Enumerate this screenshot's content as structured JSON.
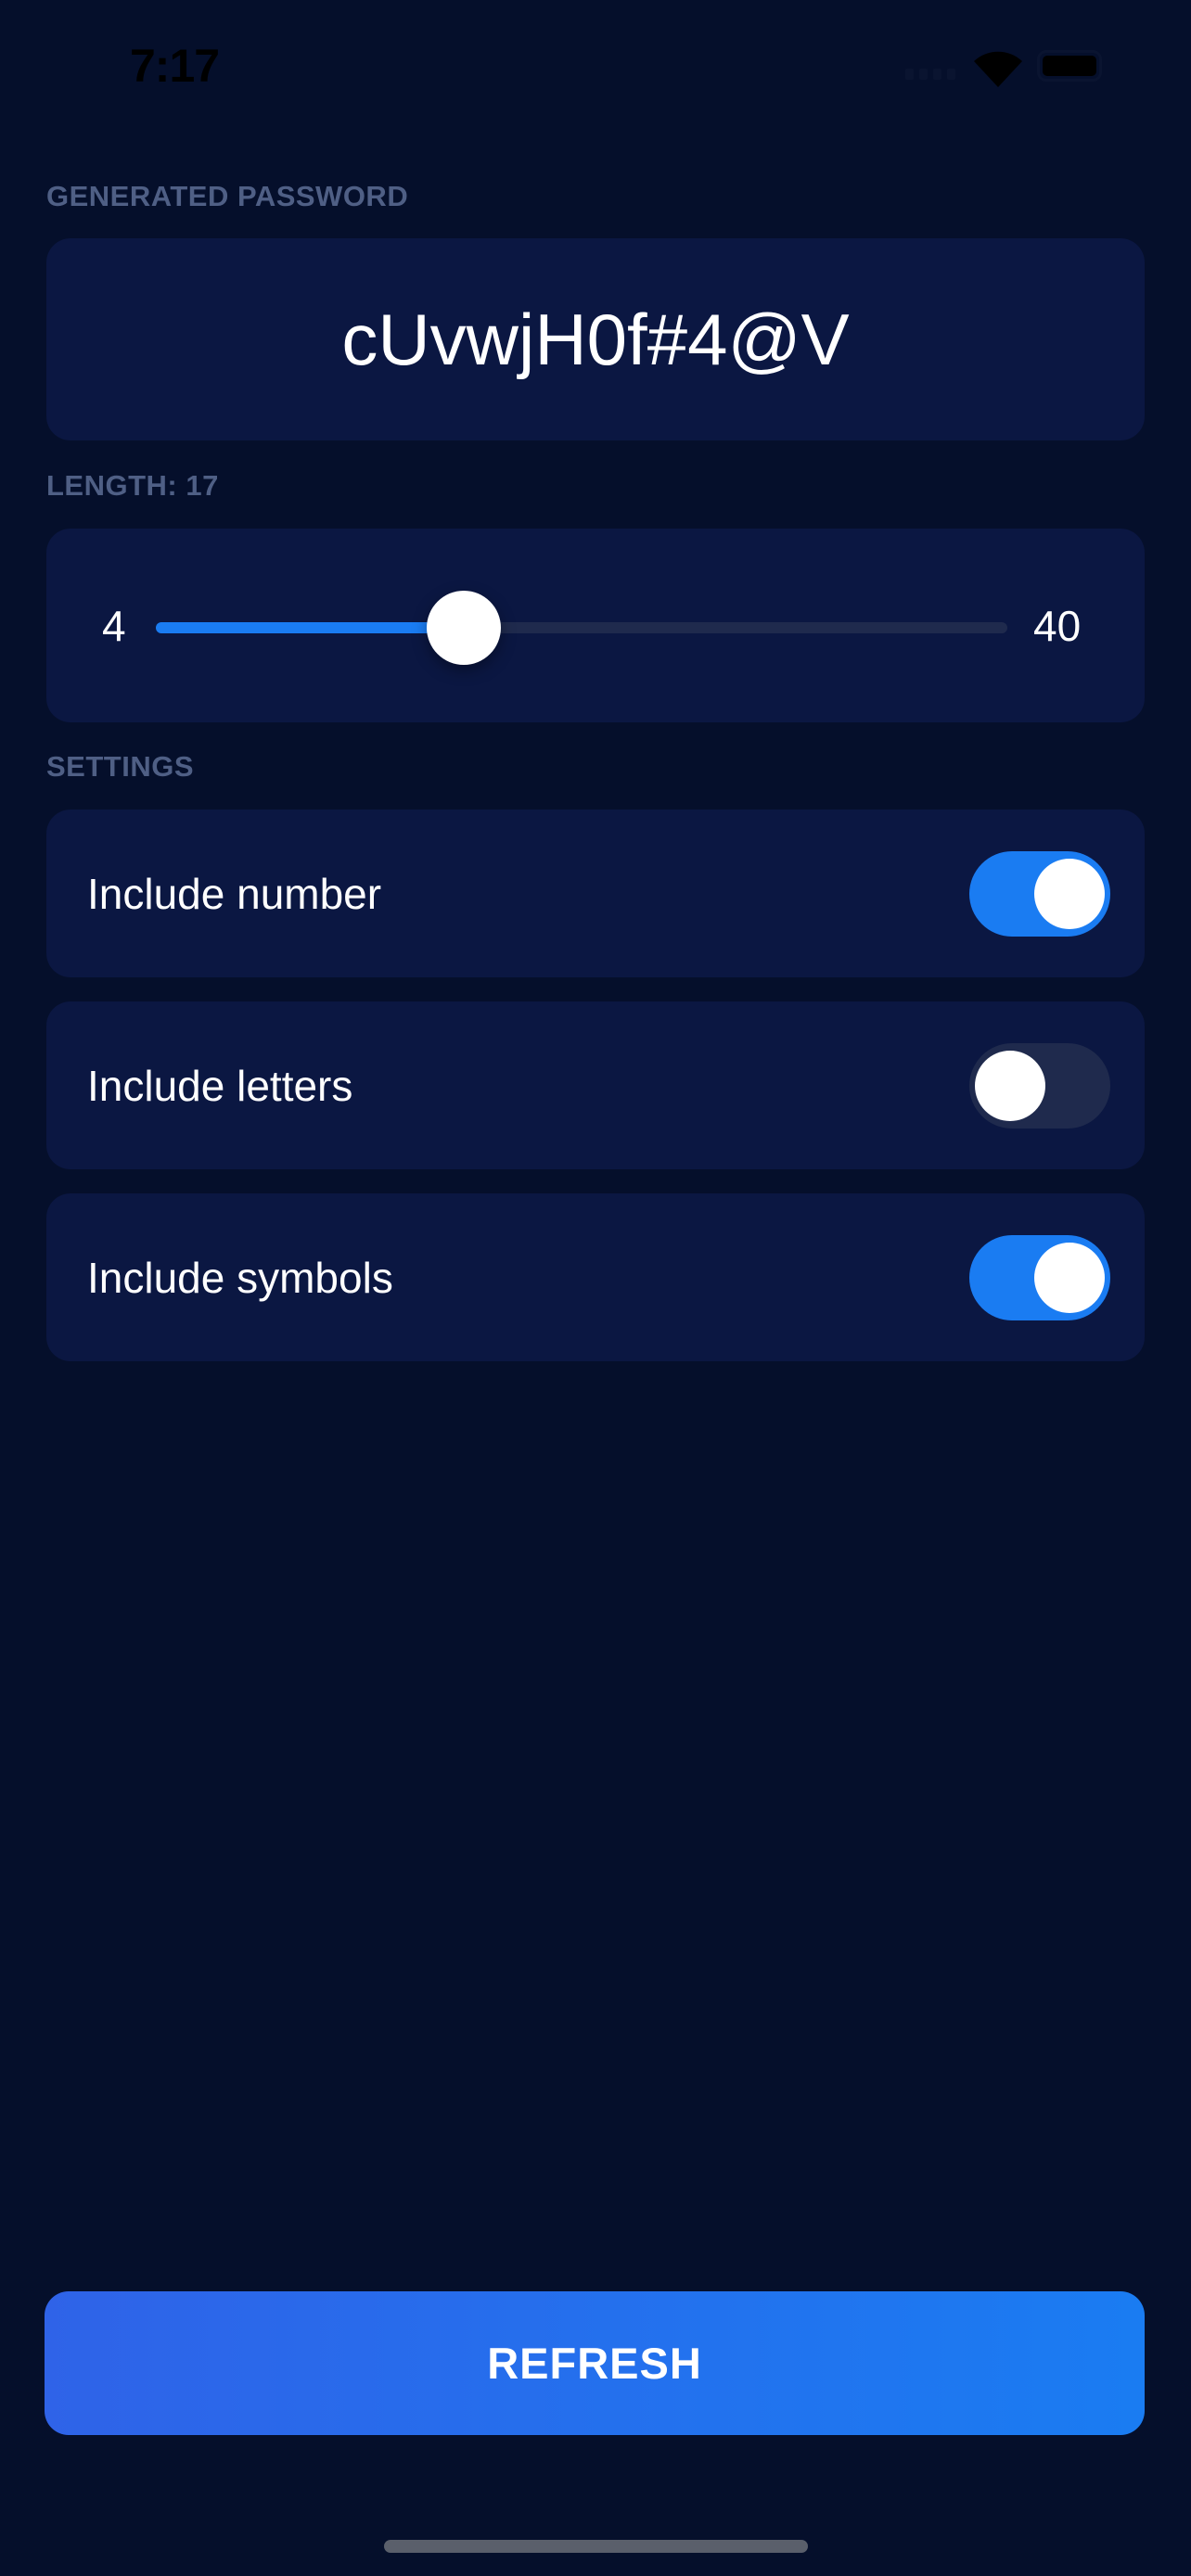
{
  "status_bar": {
    "time": "7:17",
    "icons": [
      "signal-icon",
      "wifi-icon",
      "battery-icon"
    ]
  },
  "password": {
    "label": "GENERATED PASSWORD",
    "value": "cUvwjH0f#4@V"
  },
  "length": {
    "label": "LENGTH: 17",
    "min": "4",
    "max": "40",
    "value": 17
  },
  "settings": {
    "label": "SETTINGS",
    "items": [
      {
        "label": "Include number",
        "enabled": true
      },
      {
        "label": "Include letters",
        "enabled": false
      },
      {
        "label": "Include symbols",
        "enabled": true
      }
    ]
  },
  "refresh_label": "REFRESH",
  "colors": {
    "background": "#050f2b",
    "card": "#0b1742",
    "accent": "#1a7cf2",
    "section_label": "#4f5f85"
  }
}
